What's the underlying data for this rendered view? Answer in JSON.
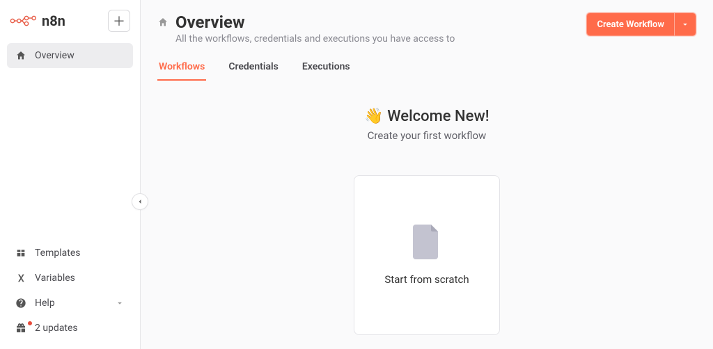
{
  "brand": "n8n",
  "sidebar": {
    "top": [
      {
        "label": "Overview"
      }
    ],
    "bottom": [
      {
        "label": "Templates"
      },
      {
        "label": "Variables"
      },
      {
        "label": "Help"
      },
      {
        "label": "2 updates"
      }
    ]
  },
  "header": {
    "title": "Overview",
    "subtitle": "All the workflows, credentials and executions you have access to",
    "create_label": "Create Workflow"
  },
  "tabs": [
    {
      "label": "Workflows"
    },
    {
      "label": "Credentials"
    },
    {
      "label": "Executions"
    }
  ],
  "welcome": {
    "emoji": "👋",
    "title": "Welcome New!",
    "subtitle": "Create your first workflow"
  },
  "card": {
    "label": "Start from scratch"
  }
}
